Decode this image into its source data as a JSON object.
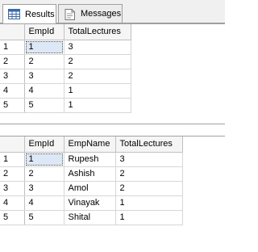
{
  "tabs": {
    "results_label": "Results",
    "messages_label": "Messages"
  },
  "grid1": {
    "columns": [
      "EmpId",
      "TotalLectures"
    ],
    "rows": [
      {
        "num": "1",
        "cells": [
          "1",
          "3"
        ]
      },
      {
        "num": "2",
        "cells": [
          "2",
          "2"
        ]
      },
      {
        "num": "3",
        "cells": [
          "3",
          "2"
        ]
      },
      {
        "num": "4",
        "cells": [
          "4",
          "1"
        ]
      },
      {
        "num": "5",
        "cells": [
          "5",
          "1"
        ]
      }
    ]
  },
  "grid2": {
    "columns": [
      "EmpId",
      "EmpName",
      "TotalLectures"
    ],
    "rows": [
      {
        "num": "1",
        "cells": [
          "1",
          "Rupesh",
          "3"
        ]
      },
      {
        "num": "2",
        "cells": [
          "2",
          "Ashish",
          "2"
        ]
      },
      {
        "num": "3",
        "cells": [
          "3",
          "Amol",
          "2"
        ]
      },
      {
        "num": "4",
        "cells": [
          "4",
          "Vinayak",
          "1"
        ]
      },
      {
        "num": "5",
        "cells": [
          "5",
          "Shital",
          "1"
        ]
      }
    ]
  },
  "colors": {
    "accent": "#1e6fd0",
    "header_bg": "#f5f5f5",
    "selected_cell_bg": "#dde8f6"
  },
  "icons": {
    "results": "results-grid-icon",
    "messages": "messages-icon"
  }
}
